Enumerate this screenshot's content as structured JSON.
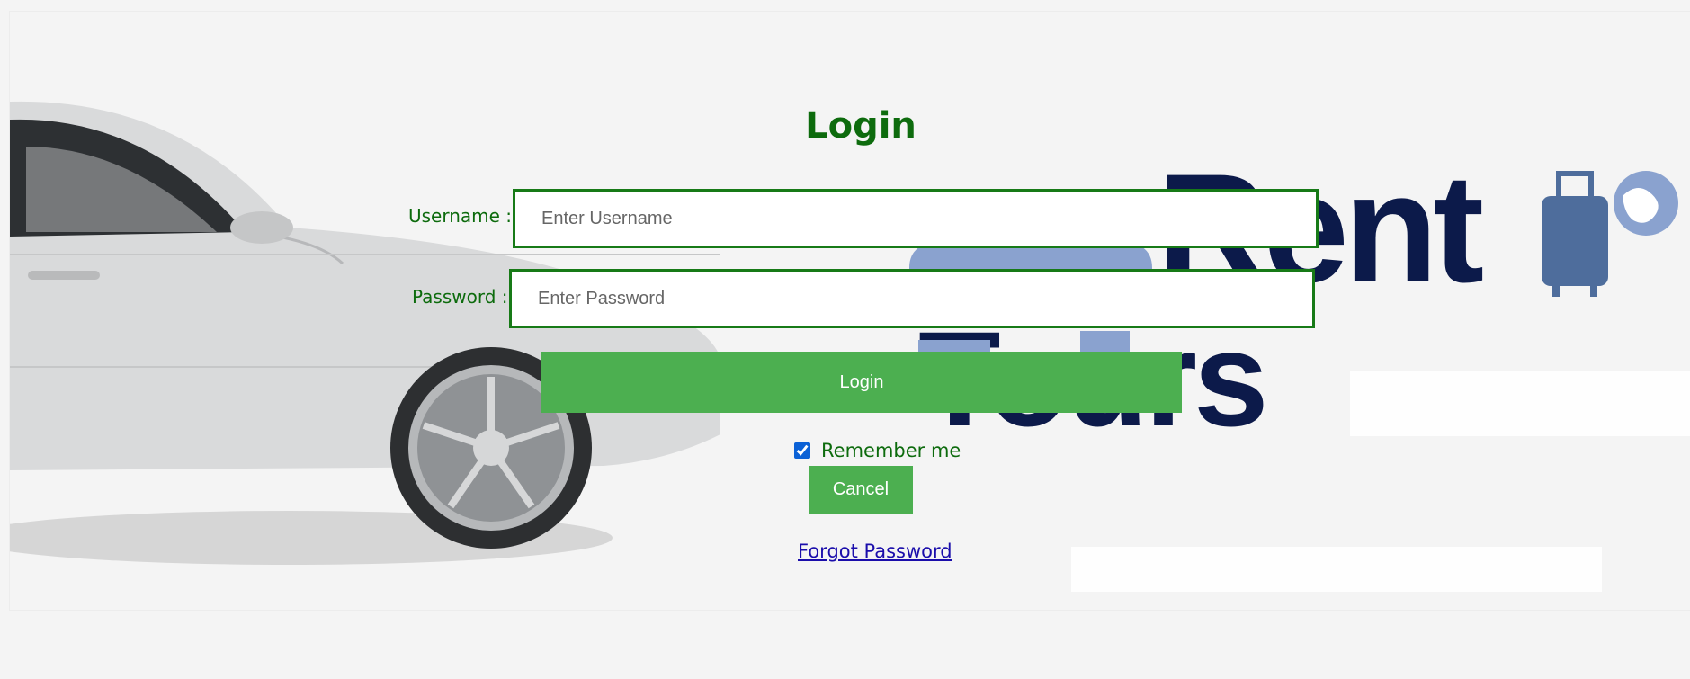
{
  "login": {
    "title": "Login",
    "username_label": "Username :",
    "username_placeholder": "Enter Username",
    "password_label": "Password :",
    "password_placeholder": "Enter Password",
    "submit_label": "Login",
    "remember_label": "Remember me",
    "remember_checked": true,
    "cancel_label": "Cancel",
    "forgot_label": "Forgot Password"
  },
  "brand": {
    "line1": "Rent",
    "line2": "Tours"
  },
  "colors": {
    "label_green": "#0d6b0d",
    "field_border": "#177a17",
    "button_green": "#4caf50",
    "link_blue": "#1a0dab",
    "brand_navy": "#0c1a4a",
    "brand_light_blue": "#8aa2cf"
  },
  "icons": [
    "car-image",
    "luggage-icon",
    "globe-icon"
  ]
}
